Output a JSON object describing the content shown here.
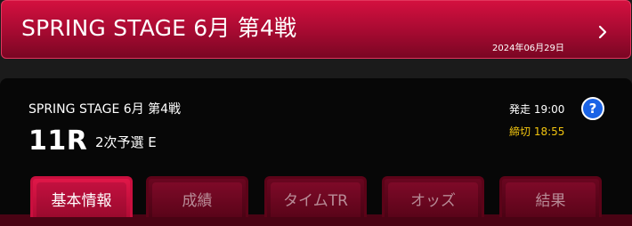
{
  "banner": {
    "title": "SPRING STAGE 6月 第4戦",
    "date": "2024年06月29日"
  },
  "race": {
    "subtitle": "SPRING STAGE 6月 第4戦",
    "number": "11R",
    "grade": "2次予選 E",
    "start_time": "発走 19:00",
    "deadline": "締切 18:55",
    "help_label": "?"
  },
  "tabs": [
    {
      "label": "基本情報",
      "active": true
    },
    {
      "label": "成績",
      "active": false
    },
    {
      "label": "タイムTR",
      "active": false
    },
    {
      "label": "オッズ",
      "active": false
    },
    {
      "label": "結果",
      "active": false
    }
  ],
  "colors": {
    "accent_red": "#c90f3e",
    "deadline_yellow": "#f1c40f",
    "help_blue": "#1a63e6"
  }
}
